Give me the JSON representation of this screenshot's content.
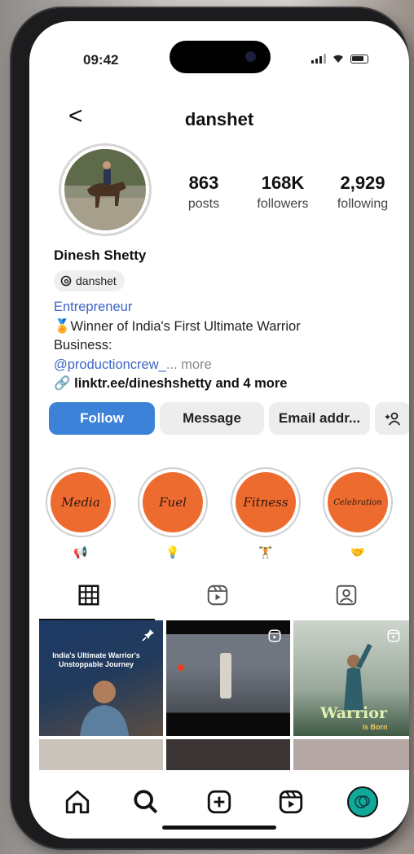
{
  "status": {
    "time": "09:42"
  },
  "header": {
    "back": "<",
    "username": "danshet"
  },
  "profile": {
    "stats": [
      {
        "value": "863",
        "label": "posts"
      },
      {
        "value": "168K",
        "label": "followers"
      },
      {
        "value": "2,929",
        "label": "following"
      }
    ],
    "full_name": "Dinesh Shetty",
    "threads_handle": "danshet",
    "category": "Entrepreneur",
    "bio_line1": "Winner of India's First Ultimate Warrior",
    "bio_line2": "Business:",
    "mention": "@productioncrew_",
    "more": "... more",
    "link": "linktr.ee/dineshshetty and 4 more"
  },
  "actions": {
    "follow": "Follow",
    "message": "Message",
    "email": "Email addr..."
  },
  "highlights": [
    {
      "title": "Media",
      "emoji": "📢"
    },
    {
      "title": "Fuel",
      "emoji": "💡"
    },
    {
      "title": "Fitness",
      "emoji": "🏋"
    },
    {
      "title": "Celebration",
      "emoji": "🤝"
    }
  ],
  "grid": {
    "post1_text": "India's Ultimate Warrior's Unstoppable Journey",
    "post3_text": "Warrior",
    "post3_sub": "is Born"
  },
  "colors": {
    "follow_bg": "#3b82d8",
    "highlight_bg": "#ee6b2f",
    "link_blue": "#3c64c6"
  }
}
